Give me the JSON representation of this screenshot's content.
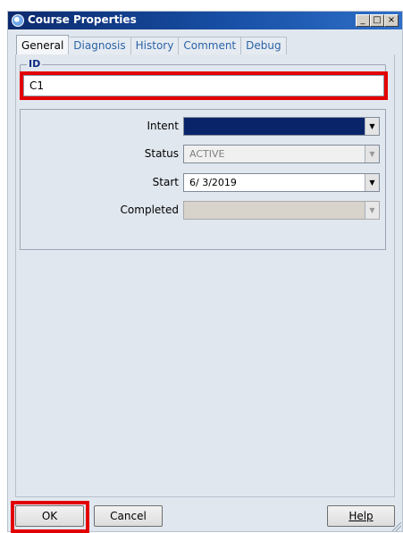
{
  "window": {
    "title": "Course Properties",
    "controls": {
      "minimize": "_",
      "maximize": "□",
      "close": "×"
    }
  },
  "tabs": [
    {
      "label": "General",
      "active": true
    },
    {
      "label": "Diagnosis",
      "active": false
    },
    {
      "label": "History",
      "active": false
    },
    {
      "label": "Comment",
      "active": false
    },
    {
      "label": "Debug",
      "active": false
    }
  ],
  "id_group": {
    "legend": "ID",
    "value": "C1"
  },
  "fields": {
    "intent": {
      "label": "Intent",
      "value": ""
    },
    "status": {
      "label": "Status",
      "value": "ACTIVE"
    },
    "start": {
      "label": "Start",
      "value": "6/ 3/2019"
    },
    "completed": {
      "label": "Completed",
      "value": ""
    }
  },
  "buttons": {
    "ok": "OK",
    "cancel": "Cancel",
    "help": "Help"
  },
  "colors": {
    "highlight_outline": "#e30000",
    "selected_fill": "#0a246a",
    "title_bar": "#174fa5"
  },
  "icons": {
    "title": "course-icon",
    "dropdown": "chevron-down-icon"
  }
}
